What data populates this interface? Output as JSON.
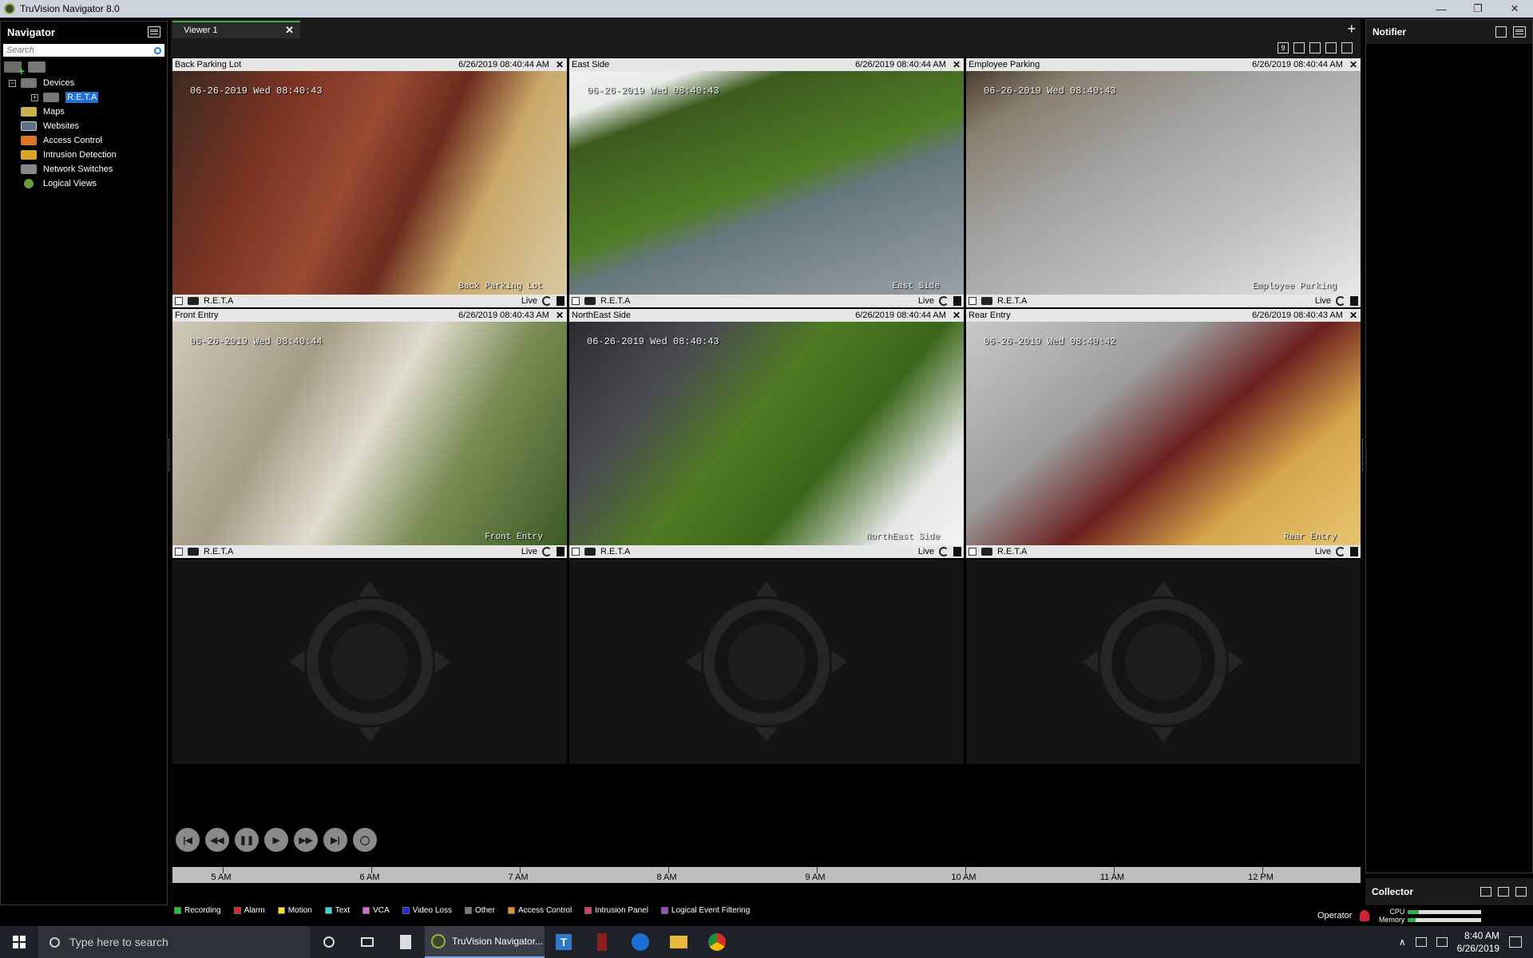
{
  "window": {
    "title": "TruVision Navigator 8.0",
    "minimize": "—",
    "restore": "❐",
    "close": "✕"
  },
  "navigator": {
    "title": "Navigator",
    "search_placeholder": "Search",
    "tree": {
      "devices": "Devices",
      "reta": "R.E.T.A",
      "maps": "Maps",
      "websites": "Websites",
      "access_control": "Access Control",
      "intrusion_detection": "Intrusion Detection",
      "network_switches": "Network Switches",
      "logical_views": "Logical Views"
    }
  },
  "viewer": {
    "tab_label": "Viewer 1",
    "tab_close": "✕",
    "new_tab": "+",
    "toolbar": {
      "layout": "9"
    },
    "cameras": [
      {
        "name": "Back Parking Lot",
        "timestamp": "6/26/2019 08:40:44 AM",
        "osd_time": "06-26-2019 Wed 08:40:43",
        "osd_name": "Back Parking Lot",
        "device": "R.E.T.A",
        "mode": "Live"
      },
      {
        "name": "East Side",
        "timestamp": "6/26/2019 08:40:44 AM",
        "osd_time": "06-26-2019 Wed 08:40:43",
        "osd_name": "East Side",
        "device": "R.E.T.A",
        "mode": "Live"
      },
      {
        "name": "Employee Parking",
        "timestamp": "6/26/2019 08:40:44 AM",
        "osd_time": "06-26-2019 Wed 08:40:43",
        "osd_name": "Employee Parking",
        "device": "R.E.T.A",
        "mode": "Live"
      },
      {
        "name": "Front Entry",
        "timestamp": "6/26/2019 08:40:43 AM",
        "osd_time": "06-26-2019 Wed 08:40:44",
        "osd_name": "Front Entry",
        "device": "R.E.T.A",
        "mode": "Live"
      },
      {
        "name": "NorthEast Side",
        "timestamp": "6/26/2019 08:40:44 AM",
        "osd_time": "06-26-2019 Wed 08:40:43",
        "osd_name": "NorthEast Side",
        "device": "R.E.T.A",
        "mode": "Live"
      },
      {
        "name": "Rear Entry",
        "timestamp": "6/26/2019 08:40:43 AM",
        "osd_time": "06-26-2019 Wed 08:40:42",
        "osd_name": "Rear Entry",
        "device": "R.E.T.A",
        "mode": "Live"
      }
    ],
    "close_glyph": "✕"
  },
  "timeline": {
    "labels": [
      "5 AM",
      "6 AM",
      "7 AM",
      "8 AM",
      "9 AM",
      "10 AM",
      "11 AM",
      "12 PM"
    ]
  },
  "legend": [
    {
      "label": "Recording",
      "color": "#1fc43b"
    },
    {
      "label": "Alarm",
      "color": "#e02424"
    },
    {
      "label": "Motion",
      "color": "#f2e32a"
    },
    {
      "label": "Text",
      "color": "#3ad6d6"
    },
    {
      "label": "VCA",
      "color": "#e06ad6"
    },
    {
      "label": "Video Loss",
      "color": "#1d2be0"
    },
    {
      "label": "Other",
      "color": "#7a7a7a"
    },
    {
      "label": "Access Control",
      "color": "#f08a24"
    },
    {
      "label": "Intrusion Panel",
      "color": "#e04060"
    },
    {
      "label": "Logical Event Filtering",
      "color": "#9a4ad6"
    }
  ],
  "notifier": {
    "title": "Notifier"
  },
  "collector": {
    "title": "Collector"
  },
  "status": {
    "operator": "Operator",
    "cpu_label": "CPU",
    "memory_label": "Memory",
    "cpu_level": 0.15,
    "memory_level": 0.1
  },
  "taskbar": {
    "search_placeholder": "Type here to search",
    "active_app": "TruVision Navigator...",
    "time": "8:40 AM",
    "date": "6/26/2019"
  }
}
